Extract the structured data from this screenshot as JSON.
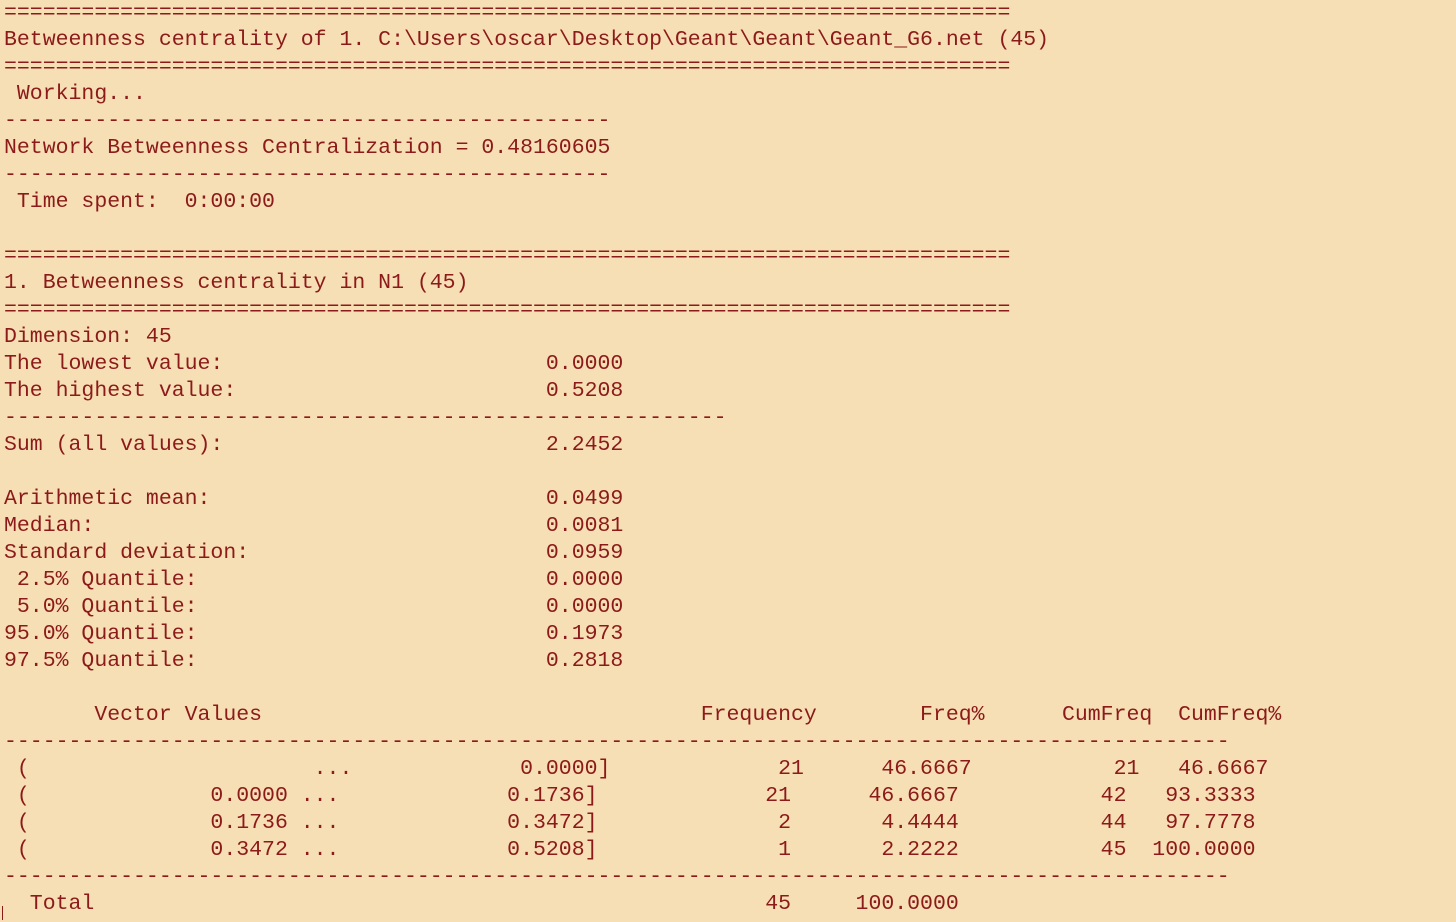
{
  "lines": [
    "==============================================================================",
    "Betweenness centrality of 1. C:\\Users\\oscar\\Desktop\\Geant\\Geant\\Geant_G6.net (45)",
    "==============================================================================",
    " Working...",
    "-----------------------------------------------",
    "Network Betweenness Centralization = 0.48160605",
    "-----------------------------------------------",
    " Time spent:  0:00:00",
    "",
    "==============================================================================",
    "1. Betweenness centrality in N1 (45)",
    "==============================================================================",
    "Dimension: 45",
    "The lowest value:                         0.0000",
    "The highest value:                        0.5208",
    "--------------------------------------------------------",
    "Sum (all values):                         2.2452",
    "",
    "Arithmetic mean:                          0.0499",
    "Median:                                   0.0081",
    "Standard deviation:                       0.0959",
    " 2.5% Quantile:                           0.0000",
    " 5.0% Quantile:                           0.0000",
    "95.0% Quantile:                           0.1973",
    "97.5% Quantile:                           0.2818",
    "",
    "       Vector Values                                  Frequency        Freq%      CumFreq  CumFreq%",
    "-----------------------------------------------------------------------------------------------",
    " (                      ...             0.0000]             21      46.6667           21   46.6667",
    " (              0.0000 ...             0.1736]             21      46.6667           42   93.3333",
    " (              0.1736 ...             0.3472]              2       4.4444           44   97.7778",
    " (              0.3472 ...             0.5208]              1       2.2222           45  100.0000",
    "-----------------------------------------------------------------------------------------------",
    "  Total                                                    45     100.0000"
  ]
}
